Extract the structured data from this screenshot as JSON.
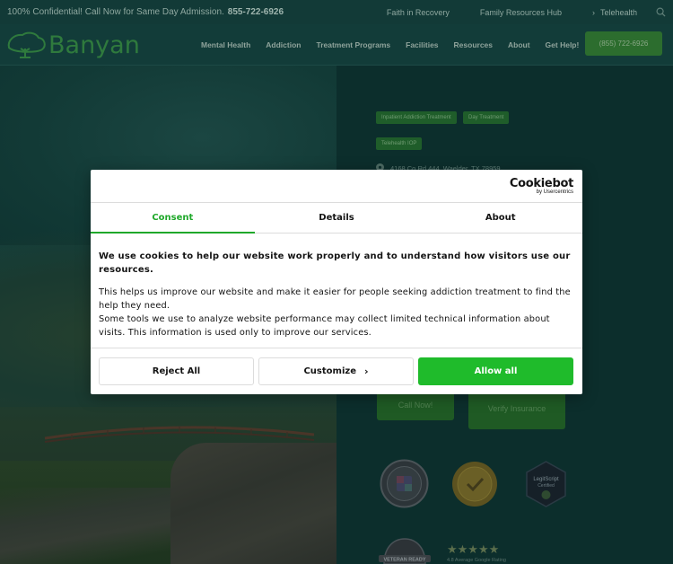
{
  "topbar": {
    "confidential": "100% Confidential! Call Now for Same Day Admission.",
    "phone": "855-722-6926",
    "links": [
      "Faith in Recovery",
      "Family Resources Hub"
    ],
    "telehealth": "Telehealth"
  },
  "header": {
    "logo_text": "Banyan",
    "nav": [
      "Mental Health",
      "Addiction",
      "Treatment Programs",
      "Facilities",
      "Resources",
      "About",
      "Get Help!"
    ],
    "cta_phone": "(855) 722-6926"
  },
  "facility": {
    "tags": [
      "Inpatient Addiction Treatment",
      "Day Treatment",
      "Telehealth IOP"
    ],
    "address": "4168 Co Rd 444, Waelder, TX 78959",
    "call_label": "Call Now!",
    "verify_label": "Verify Insurance",
    "rating_stars": "★★★★★",
    "rating_text": "4.8 Average Google Rating",
    "badges": [
      "hipaa-seal-icon",
      "joint-commission-seal-icon",
      "legitscript-certified-icon",
      "veteran-ready-icon"
    ]
  },
  "cookie_dialog": {
    "brand": "Cookiebot",
    "brand_by": "by Usercentrics",
    "tabs": [
      "Consent",
      "Details",
      "About"
    ],
    "headline": "We use cookies to help our website work properly and to understand how visitors use our resources.",
    "para1": "This helps us improve our website and make it easier for people seeking addiction treatment to find the help they need.",
    "para2": "Some tools we use to analyze website performance may collect limited technical information about visits. This information is used only to improve our services.",
    "reject_label": "Reject All",
    "customize_label": "Customize",
    "allow_label": "Allow all",
    "accent": "#1fbb2b"
  },
  "colors": {
    "overlay_bg": "#0c2e2c",
    "brand_green": "#2f7a3d"
  }
}
